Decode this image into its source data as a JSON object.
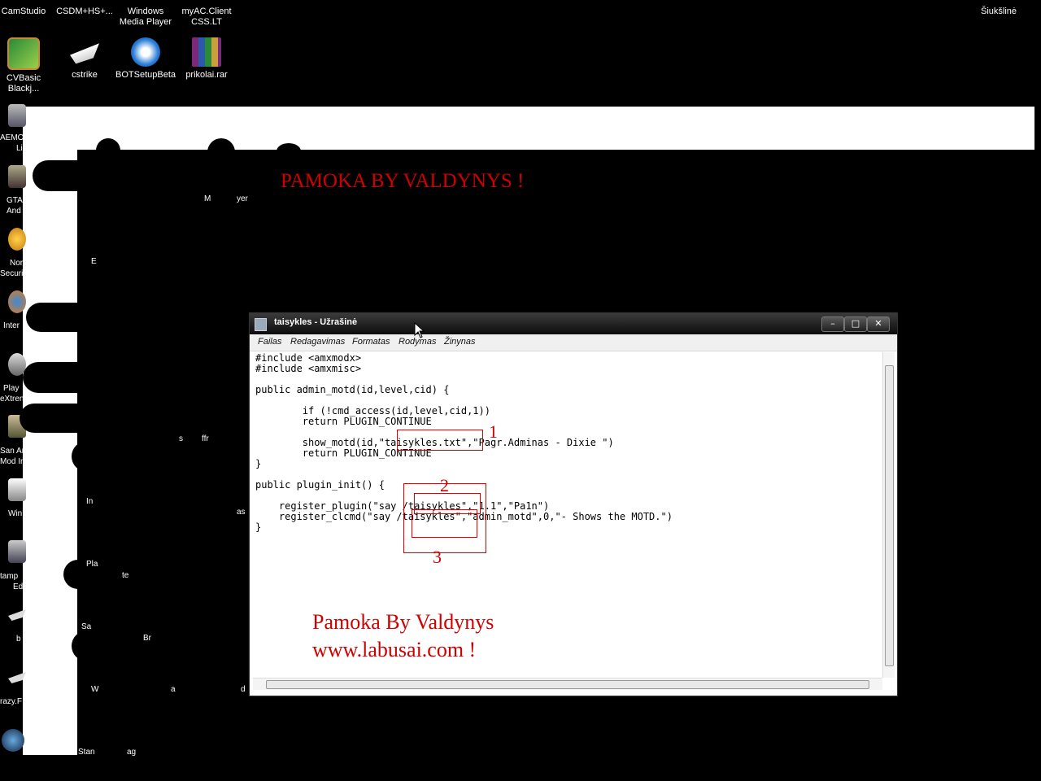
{
  "desktop": {
    "icons_top": [
      {
        "label": "CamStudio"
      },
      {
        "label": "CSDM+HS+..."
      },
      {
        "label": "Windows Media Player"
      },
      {
        "label": "myAC.Client CSS.LT"
      }
    ],
    "icons_row2": [
      {
        "label": "CVBasic Blackj..."
      },
      {
        "label": "cstrike"
      },
      {
        "label": "BOTSetupBeta"
      },
      {
        "label": "prikolai.rar"
      }
    ],
    "recycle_bin": "Šiukšlinė",
    "left_edge_labels": [
      "AEMO",
      "Li",
      "GTA",
      "And",
      "Nor",
      "Securit",
      "Inter",
      "Play",
      "eXtren",
      "San Ar",
      "Mod In",
      "Win",
      "tamp",
      "Edi",
      "b",
      "razy.F"
    ],
    "middle_labels": [
      "M",
      "yer",
      "E",
      "s",
      "ffr",
      "In",
      "Pla",
      "te",
      "Sa",
      "Br",
      "W",
      "a",
      "d",
      "Stan",
      "ag",
      "as"
    ],
    "colors": {
      "accent_red": "#d00000",
      "background": "#000000"
    }
  },
  "overlay": {
    "heading": "PAMOKA BY VALDYNYS !",
    "footer_line1": "Pamoka By Valdynys",
    "footer_line2": "www.labusai.com !",
    "markers": [
      "1",
      "2",
      "3"
    ]
  },
  "notepad": {
    "title": "taisykles - Užrašinė",
    "buttons": {
      "minimize": "–",
      "maximize": "□",
      "close": "✕"
    },
    "menu": [
      "Failas",
      "Redagavimas",
      "Formatas",
      "Rodymas",
      "Žinynas"
    ],
    "code_lines": [
      "#include <amxmodx>",
      "#include <amxmisc>",
      "",
      "public admin_motd(id,level,cid) {",
      "",
      "        if (!cmd_access(id,level,cid,1))",
      "        return PLUGIN_CONTINUE",
      "",
      "        show_motd(id,\"taisykles.txt\",\"Pagr.Adminas - Dixie \")",
      "        return PLUGIN_CONTINUE",
      "}",
      "",
      "public plugin_init() {",
      "",
      "    register_plugin(\"say /taisykles\",\"1.1\",\"Pa1n\")",
      "    register_clcmd(\"say /taisykles\",\"admin_motd\",0,\"- Shows the MOTD.\")",
      "}"
    ]
  }
}
